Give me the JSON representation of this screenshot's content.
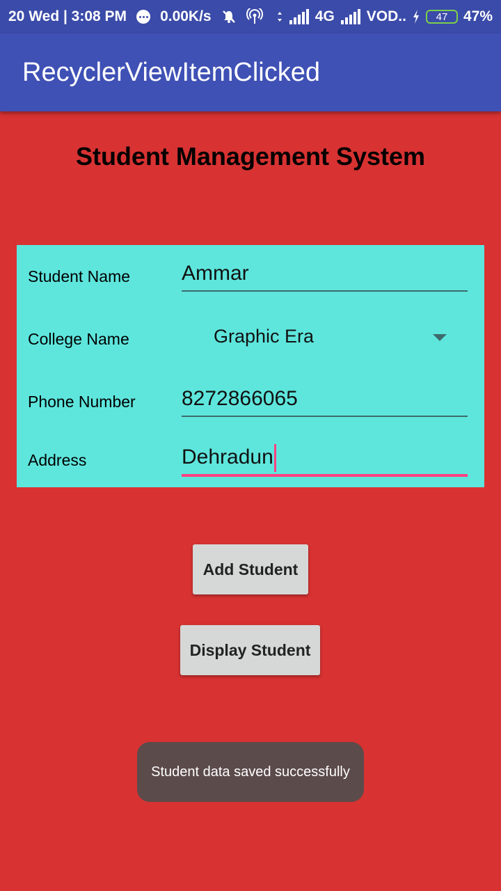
{
  "status_bar": {
    "date_time": "20 Wed | 3:08 PM",
    "speed": "0.00K/s",
    "network": "4G",
    "carrier": "VOD..",
    "battery_level": "47",
    "battery_percent": "47%"
  },
  "app_bar": {
    "title": "RecyclerViewItemClicked"
  },
  "header": {
    "title": "Student Management System"
  },
  "form": {
    "student_name_label": "Student Name",
    "student_name_value": "Ammar",
    "college_name_label": "College Name",
    "college_name_selected": "Graphic Era",
    "phone_label": "Phone Number",
    "phone_value": "8272866065",
    "address_label": "Address",
    "address_value": "Dehradun"
  },
  "buttons": {
    "add_student": "Add Student",
    "display_student": "Display Student"
  },
  "toast": {
    "message": "Student data saved successfully"
  },
  "colors": {
    "status_bar": "#3b4ba9",
    "app_bar": "#3f51b5",
    "background": "#d83232",
    "form_panel": "#5ee6dd",
    "accent": "#ff4081",
    "button": "#d6d7d7",
    "toast": "#5c4b4b"
  },
  "icons": [
    "notification-dot-icon",
    "mute-icon",
    "hotspot-icon",
    "data-arrows-icon",
    "signal-icon",
    "charging-icon",
    "battery-icon"
  ]
}
